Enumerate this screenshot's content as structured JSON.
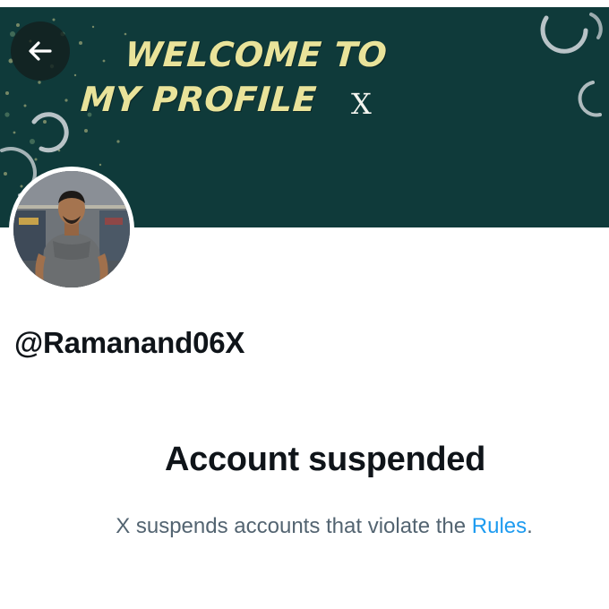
{
  "banner": {
    "title_line1": "WELCOME TO",
    "title_line2": "MY PROFILE",
    "x_glyph": "X",
    "background_color": "#0f3a3a",
    "title_color": "#e9e39a"
  },
  "back_button": {
    "icon": "arrow-left-icon"
  },
  "profile": {
    "handle": "@Ramanand06X"
  },
  "suspension": {
    "title": "Account suspended",
    "description_prefix": "X suspends accounts that violate the ",
    "rules_link": "Rules",
    "description_suffix": ".",
    "link_color": "#1d9bf0"
  }
}
